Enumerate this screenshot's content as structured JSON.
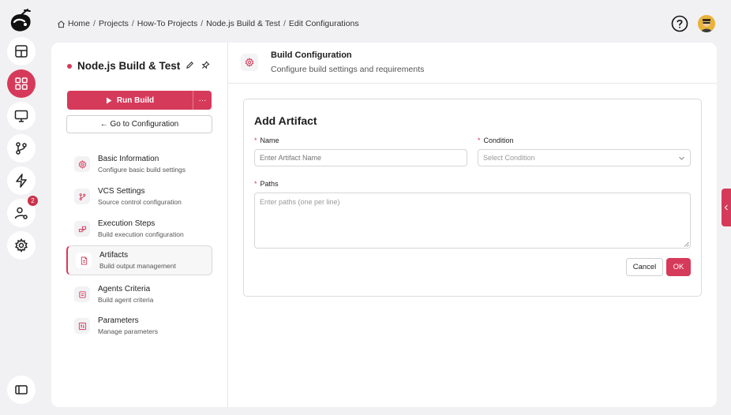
{
  "breadcrumb": {
    "items": [
      "Home",
      "Projects",
      "How-To Projects",
      "Node.js Build & Test",
      "Edit Configurations"
    ],
    "separator": "/"
  },
  "rail": {
    "notifications_badge": "2"
  },
  "project": {
    "title": "Node.js Build & Test",
    "run_label": "Run Build",
    "more_label": "···",
    "goto_label": "← Go to Configuration"
  },
  "nav": {
    "items": [
      {
        "title": "Basic Information",
        "subtitle": "Configure basic build settings"
      },
      {
        "title": "VCS Settings",
        "subtitle": "Source control configuration"
      },
      {
        "title": "Execution Steps",
        "subtitle": "Build execution configuration"
      },
      {
        "title": "Artifacts",
        "subtitle": "Build output management"
      },
      {
        "title": "Agents Criteria",
        "subtitle": "Build agent criteria"
      },
      {
        "title": "Parameters",
        "subtitle": "Manage parameters"
      }
    ],
    "active_index": 3
  },
  "content": {
    "title": "Build Configuration",
    "subtitle": "Configure build settings and requirements"
  },
  "form": {
    "title": "Add Artifact",
    "required_mark": "*",
    "name_label": "Name",
    "name_placeholder": "Enter Artifact Name",
    "condition_label": "Condition",
    "condition_placeholder": "Select Condition",
    "paths_label": "Paths",
    "paths_placeholder": "Enter paths (one per line)",
    "cancel_label": "Cancel",
    "ok_label": "OK"
  },
  "colors": {
    "accent": "#d63a5a",
    "background": "#f1f1f3"
  }
}
